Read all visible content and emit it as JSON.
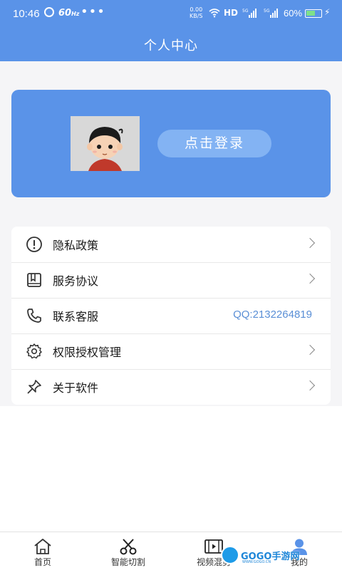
{
  "status_bar": {
    "time": "10:46",
    "speed_indicator": "60",
    "speed_unit": "Hz",
    "more_dots": "•••",
    "net_speed_value": "0.00",
    "net_speed_unit": "KB/S",
    "hd_label": "HD",
    "signal_label": "5G",
    "battery_percent": "60%",
    "battery_level": 0.6,
    "icons": [
      "alarm-icon",
      "wifi-icon",
      "signal-icon",
      "battery-icon",
      "charging-icon"
    ]
  },
  "header": {
    "title": "个人中心"
  },
  "profile": {
    "login_label": "点击登录"
  },
  "menu": {
    "items": [
      {
        "icon": "info-circle-icon",
        "label": "隐私政策",
        "value": "",
        "chevron": true
      },
      {
        "icon": "book-icon",
        "label": "服务协议",
        "value": "",
        "chevron": true
      },
      {
        "icon": "phone-icon",
        "label": "联系客服",
        "value": "QQ:2132264819",
        "chevron": false
      },
      {
        "icon": "gear-icon",
        "label": "权限授权管理",
        "value": "",
        "chevron": true
      },
      {
        "icon": "pin-icon",
        "label": "关于软件",
        "value": "",
        "chevron": true
      }
    ]
  },
  "bottom_nav": {
    "items": [
      {
        "icon": "home-icon",
        "label": "首页"
      },
      {
        "icon": "scissors-icon",
        "label": "智能切割"
      },
      {
        "icon": "film-icon",
        "label": "视频混剪"
      },
      {
        "icon": "user-icon",
        "label": "我的"
      }
    ],
    "active_index": 3
  },
  "watermark": {
    "text": "GOGO手游网",
    "sub": "WWW.GOGO.CN"
  },
  "colors": {
    "primary": "#5a93e8",
    "button": "#83b3f3",
    "link": "#5a8fd6",
    "background": "#f5f5f7"
  }
}
